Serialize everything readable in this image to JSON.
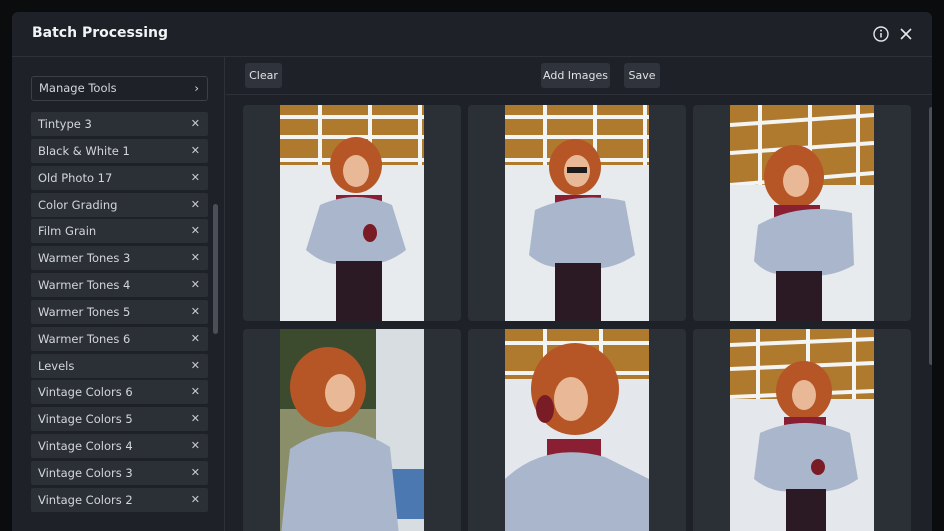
{
  "dialog": {
    "title": "Batch Processing"
  },
  "sidebar": {
    "manage_label": "Manage Tools",
    "tools": [
      "Tintype 3",
      "Black & White 1",
      "Old Photo 17",
      "Color Grading",
      "Film Grain",
      "Warmer Tones 3",
      "Warmer Tones 4",
      "Warmer Tones 5",
      "Warmer Tones 6",
      "Levels",
      "Vintage Colors 6",
      "Vintage Colors 5",
      "Vintage Colors 4",
      "Vintage Colors 3",
      "Vintage Colors 2"
    ]
  },
  "toolbar": {
    "clear_label": "Clear",
    "add_label": "Add Images",
    "save_label": "Save"
  },
  "icons": {
    "info": "info-icon",
    "close": "close-icon",
    "chevron": "chevron-right-icon",
    "remove": "x-icon"
  },
  "colors": {
    "coat": "#aab6cc",
    "hair": "#b65525",
    "top": "#8a1f33",
    "pants": "#2b1a24"
  }
}
